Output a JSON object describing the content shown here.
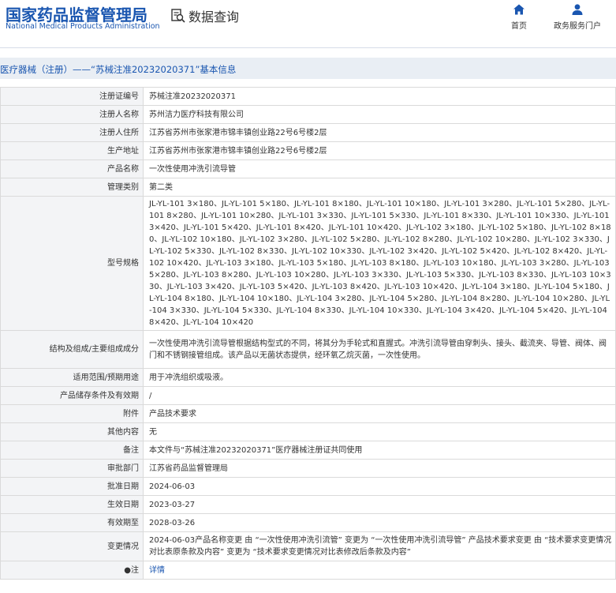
{
  "header": {
    "logo_cn": "国家药品监督管理局",
    "logo_en": "National Medical Products Administration",
    "query_label": "数据查询",
    "nav": [
      {
        "label": "首页",
        "icon": "home-icon"
      },
      {
        "label": "政务服务门户",
        "icon": "user-icon"
      }
    ]
  },
  "breadcrumb_title": "医疗器械（注册）——“苏械注准20232020371”基本信息",
  "rows": [
    {
      "label": "注册证编号",
      "value": "苏械注准20232020371"
    },
    {
      "label": "注册人名称",
      "value": "苏州洁力医疗科技有限公司"
    },
    {
      "label": "注册人住所",
      "value": "江苏省苏州市张家港市锦丰镇创业路22号6号楼2层"
    },
    {
      "label": "生产地址",
      "value": "江苏省苏州市张家港市锦丰镇创业路22号6号楼2层"
    },
    {
      "label": "产品名称",
      "value": "一次性使用冲洗引流导管"
    },
    {
      "label": "管理类别",
      "value": "第二类"
    },
    {
      "label": "型号规格",
      "value": "JL-YL-101 3×180、JL-YL-101 5×180、JL-YL-101 8×180、JL-YL-101 10×180、JL-YL-101 3×280、JL-YL-101 5×280、JL-YL-101 8×280、JL-YL-101 10×280、JL-YL-101 3×330、JL-YL-101 5×330、JL-YL-101 8×330、JL-YL-101 10×330、JL-YL-101 3×420、JL-YL-101 5×420、JL-YL-101 8×420、JL-YL-101 10×420、JL-YL-102 3×180、JL-YL-102 5×180、JL-YL-102 8×180、JL-YL-102 10×180、JL-YL-102 3×280、JL-YL-102 5×280、JL-YL-102 8×280、JL-YL-102 10×280、JL-YL-102 3×330、JL-YL-102 5×330、JL-YL-102 8×330、JL-YL-102 10×330、JL-YL-102 3×420、JL-YL-102 5×420、JL-YL-102 8×420、JL-YL-102 10×420、JL-YL-103 3×180、JL-YL-103 5×180、JL-YL-103 8×180、JL-YL-103 10×180、JL-YL-103 3×280、JL-YL-103 5×280、JL-YL-103 8×280、JL-YL-103 10×280、JL-YL-103 3×330、JL-YL-103 5×330、JL-YL-103 8×330、JL-YL-103 10×330、JL-YL-103 3×420、JL-YL-103 5×420、JL-YL-103 8×420、JL-YL-103 10×420、JL-YL-104 3×180、JL-YL-104 5×180、JL-YL-104 8×180、JL-YL-104 10×180、JL-YL-104 3×280、JL-YL-104 5×280、JL-YL-104 8×280、JL-YL-104 10×280、JL-YL-104 3×330、JL-YL-104 5×330、JL-YL-104 8×330、JL-YL-104 10×330、JL-YL-104 3×420、JL-YL-104 5×420、JL-YL-104 8×420、JL-YL-104 10×420"
    },
    {
      "label": "结构及组成/主要组成成分",
      "value": "一次性使用冲洗引流导管根据结构型式的不同，将其分为手轮式和直握式。冲洗引流导管由穿刺头、接头、截流夹、导管、阀体、阀门和不锈钢接管组成。该产品以无菌状态提供，经环氧乙烷灭菌，一次性使用。"
    },
    {
      "label": "适用范围/预期用途",
      "value": "用于冲洗组织或吸液。"
    },
    {
      "label": "产品储存条件及有效期",
      "value": "/"
    },
    {
      "label": "附件",
      "value": "产品技术要求"
    },
    {
      "label": "其他内容",
      "value": "无"
    },
    {
      "label": "备注",
      "value": "本文件与“苏械注准20232020371”医疗器械注册证共同使用"
    },
    {
      "label": "审批部门",
      "value": "江苏省药品监督管理局"
    },
    {
      "label": "批准日期",
      "value": "2024-06-03"
    },
    {
      "label": "生效日期",
      "value": "2023-03-27"
    },
    {
      "label": "有效期至",
      "value": "2028-03-26"
    },
    {
      "label": "变更情况",
      "value": "2024-06-03产品名称变更 由 “一次性使用冲洗引流管” 变更为 “一次性使用冲洗引流导管” 产品技术要求变更 由 “技术要求变更情况对比表原条款及内容” 变更为 “技术要求变更情况对比表修改后条款及内容”"
    }
  ],
  "note": {
    "label": "●注",
    "link": "详情"
  },
  "colors": {
    "brand": "#1a56b0",
    "label_bg": "#f3f4f6",
    "title_bg": "#e9eef4",
    "border": "#dadada"
  }
}
